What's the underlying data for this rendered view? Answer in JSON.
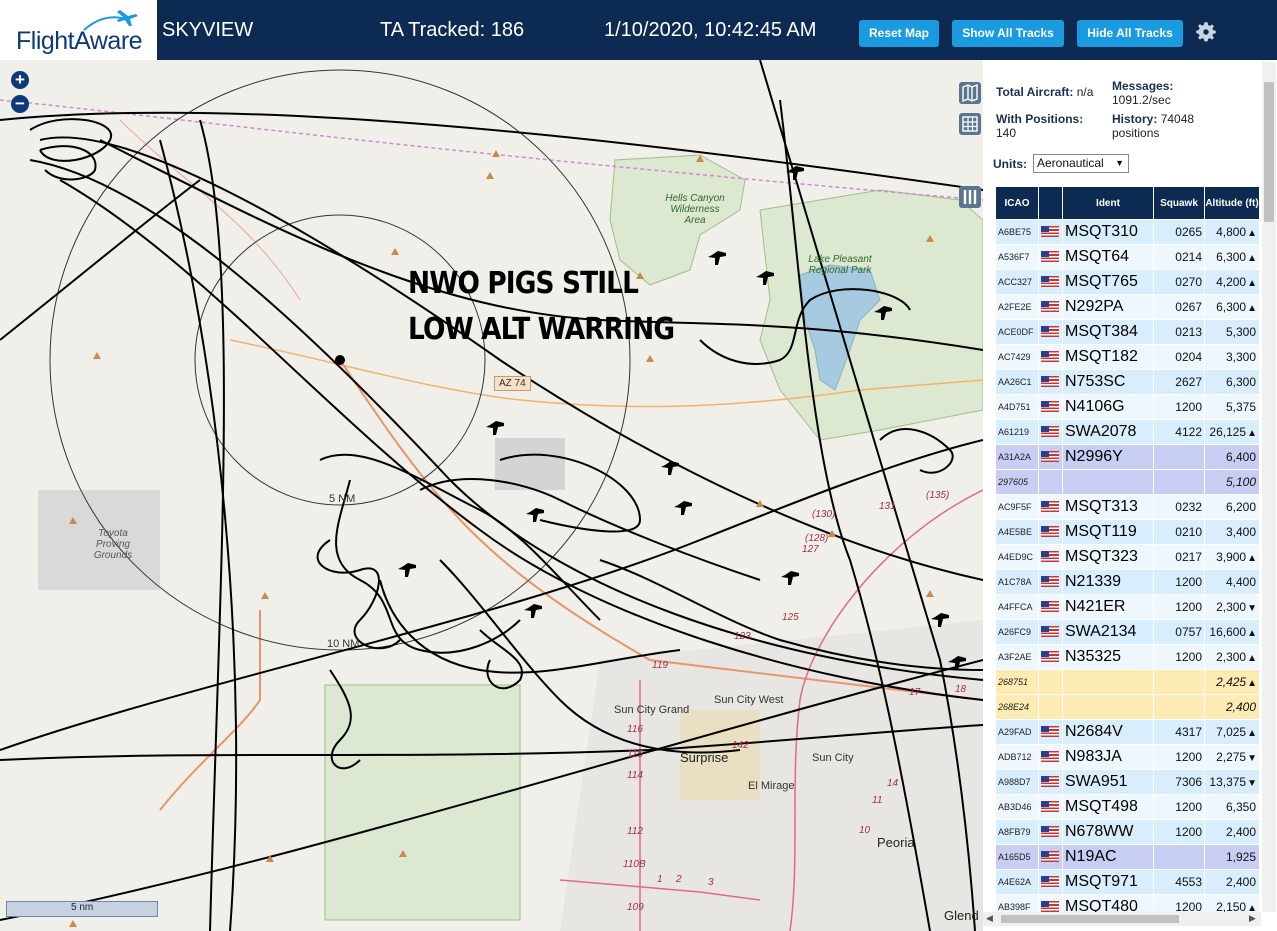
{
  "header": {
    "brand": "FlightAware",
    "app_name": "SKYVIEW",
    "tracked": "TA Tracked: 186",
    "datetime": "1/10/2020, 10:42:45 AM",
    "reset_label": "Reset Map",
    "show_label": "Show All Tracks",
    "hide_label": "Hide All Tracks",
    "settings_icon": "gear-icon"
  },
  "map": {
    "zoom_in": "+",
    "zoom_out": "−",
    "overlay_line1": "NWO PIGS STILL",
    "overlay_line2": "LOW ALT WARRING",
    "range_5": "5 NM",
    "range_10": "10 NM",
    "scale": "5 nm",
    "labels": {
      "hells_canyon": "Hells Canyon Wilderness Area",
      "lake_pleasant": "Lake Pleasant Regional Park",
      "toyota": "Toyota Proving Grounds",
      "az74": "AZ 74",
      "sun_city_grand": "Sun City Grand",
      "sun_city_west": "Sun City West",
      "surprise": "Surprise",
      "sun_city": "Sun City",
      "el_mirage": "El Mirage",
      "peoria": "Peoria",
      "glendale": "Glend"
    },
    "roads": [
      "(135)",
      "(130)",
      "131",
      "(128)",
      "127",
      "125",
      "123",
      "119",
      "116",
      "115",
      "114",
      "112",
      "110B",
      "109",
      "142",
      "17",
      "18",
      "14",
      "11",
      "10",
      "1",
      "2",
      "3"
    ]
  },
  "stats": {
    "total_label": "Total Aircraft:",
    "total_value": "n/a",
    "messages_label": "Messages:",
    "messages_value": "1091.2/sec",
    "positions_label": "With Positions:",
    "positions_value": "140",
    "history_label": "History:",
    "history_value": "74048",
    "history_unit": "positions"
  },
  "units": {
    "label": "Units:",
    "value": "Aeronautical"
  },
  "table": {
    "headers": {
      "icao": "ICAO",
      "flag": "",
      "ident": "Ident",
      "squawk": "Squawk",
      "altitude": "Altitude (ft)"
    },
    "rows": [
      {
        "icao": "A6BE75",
        "ident": "MSQT310",
        "squawk": "0265",
        "alt": "4,800",
        "trend": "▲"
      },
      {
        "icao": "A536F7",
        "ident": "MSQT64",
        "squawk": "0214",
        "alt": "6,300",
        "trend": "▲"
      },
      {
        "icao": "ACC327",
        "ident": "MSQT765",
        "squawk": "0270",
        "alt": "4,200",
        "trend": "▲"
      },
      {
        "icao": "A2FE2E",
        "ident": "N292PA",
        "squawk": "0267",
        "alt": "6,300",
        "trend": "▲"
      },
      {
        "icao": "ACE0DF",
        "ident": "MSQT384",
        "squawk": "0213",
        "alt": "5,300",
        "trend": ""
      },
      {
        "icao": "AC7429",
        "ident": "MSQT182",
        "squawk": "0204",
        "alt": "3,300",
        "trend": ""
      },
      {
        "icao": "AA26C1",
        "ident": "N753SC",
        "squawk": "2627",
        "alt": "6,300",
        "trend": ""
      },
      {
        "icao": "A4D751",
        "ident": "N4106G",
        "squawk": "1200",
        "alt": "5,375",
        "trend": ""
      },
      {
        "icao": "A61219",
        "ident": "SWA2078",
        "squawk": "4122",
        "alt": "26,125",
        "trend": "▲"
      },
      {
        "icao": "A31A2A",
        "ident": "N2996Y",
        "squawk": "",
        "alt": "6,400",
        "trend": ""
      },
      {
        "icao": "297605",
        "ident": "",
        "squawk": "",
        "alt": "5,100",
        "trend": ""
      },
      {
        "icao": "AC9F5F",
        "ident": "MSQT313",
        "squawk": "0232",
        "alt": "6,200",
        "trend": ""
      },
      {
        "icao": "A4E5BE",
        "ident": "MSQT119",
        "squawk": "0210",
        "alt": "3,400",
        "trend": ""
      },
      {
        "icao": "A4ED9C",
        "ident": "MSQT323",
        "squawk": "0217",
        "alt": "3,900",
        "trend": "▲"
      },
      {
        "icao": "A1C78A",
        "ident": "N21339",
        "squawk": "1200",
        "alt": "4,400",
        "trend": ""
      },
      {
        "icao": "A4FFCA",
        "ident": "N421ER",
        "squawk": "1200",
        "alt": "2,300",
        "trend": "▼"
      },
      {
        "icao": "A26FC9",
        "ident": "SWA2134",
        "squawk": "0757",
        "alt": "16,600",
        "trend": "▲"
      },
      {
        "icao": "A3F2AE",
        "ident": "N35325",
        "squawk": "1200",
        "alt": "2,300",
        "trend": "▲"
      },
      {
        "icao": "268751",
        "ident": "",
        "squawk": "",
        "alt": "2,425",
        "trend": "▲"
      },
      {
        "icao": "268E24",
        "ident": "",
        "squawk": "",
        "alt": "2,400",
        "trend": ""
      },
      {
        "icao": "A29FAD",
        "ident": "N2684V",
        "squawk": "4317",
        "alt": "7,025",
        "trend": "▲"
      },
      {
        "icao": "ADB712",
        "ident": "N983JA",
        "squawk": "1200",
        "alt": "2,275",
        "trend": "▼"
      },
      {
        "icao": "A988D7",
        "ident": "SWA951",
        "squawk": "7306",
        "alt": "13,375",
        "trend": "▼"
      },
      {
        "icao": "AB3D46",
        "ident": "MSQT498",
        "squawk": "1200",
        "alt": "6,350",
        "trend": ""
      },
      {
        "icao": "A8FB79",
        "ident": "N678WW",
        "squawk": "1200",
        "alt": "2,400",
        "trend": ""
      },
      {
        "icao": "A165D5",
        "ident": "N19AC",
        "squawk": "",
        "alt": "1,925",
        "trend": ""
      },
      {
        "icao": "A4E62A",
        "ident": "MSQT971",
        "squawk": "4553",
        "alt": "2,400",
        "trend": ""
      },
      {
        "icao": "AB398F",
        "ident": "MSQT480",
        "squawk": "1200",
        "alt": "2,150",
        "trend": "▲"
      }
    ]
  },
  "colors": {
    "header_bg": "#0d2a52",
    "button": "#1a9be0",
    "row_a": "#d9eefc",
    "row_b": "#eef7fe",
    "row_selected": "#c8cdf3",
    "row_mlat": "#fcebb2"
  }
}
